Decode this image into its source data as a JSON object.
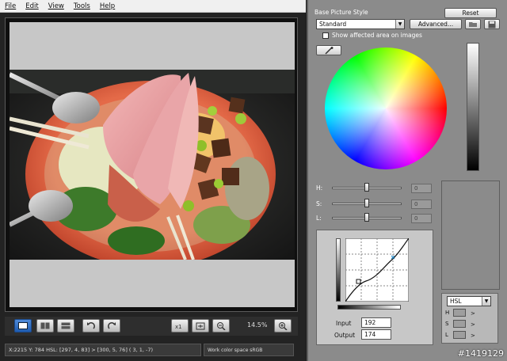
{
  "menu": {
    "items": [
      "File",
      "Edit",
      "View",
      "Tools",
      "Help"
    ]
  },
  "viewer": {
    "zoom": "14.5%",
    "toolbar_icons": [
      "single-view-icon",
      "compare-view-icon",
      "split-view-icon",
      "undo-icon",
      "redo-icon",
      "actual-size-icon",
      "fit-window-icon",
      "zoom-out-icon",
      "zoom-in-icon"
    ]
  },
  "status": {
    "readout": "X:2215 Y: 784  HSL: [297,  4, 83] > [300,  5, 76]  (  3,  1, -7)",
    "color_space": "Work color space  sRGB"
  },
  "picture_style": {
    "section_label": "Base Picture Style",
    "reset_label": "Reset",
    "style_value": "Standard",
    "advanced_label": "Advanced...",
    "show_affected_label": "Show affected area on images",
    "show_affected_checked": false
  },
  "hsl_sliders": {
    "h_label": "H:",
    "s_label": "S:",
    "l_label": "L:",
    "h_value": "0",
    "s_value": "0",
    "l_value": "0"
  },
  "curve": {
    "input_label": "Input",
    "input_value": "192",
    "output_label": "Output",
    "output_value": "174"
  },
  "color_readout": {
    "mode": "HSL",
    "rows": [
      {
        "label": "H",
        "arrow": ">"
      },
      {
        "label": "S",
        "arrow": ">"
      },
      {
        "label": "L",
        "arrow": ">"
      }
    ]
  },
  "watermark": "#1419129"
}
